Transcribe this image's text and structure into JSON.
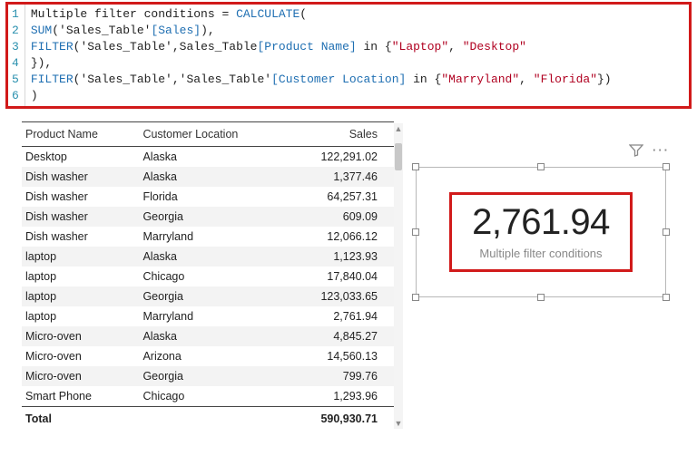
{
  "formula": {
    "lines": [
      [
        {
          "t": "Multiple filter conditions = ",
          "c": "k-plain"
        },
        {
          "t": "CALCULATE",
          "c": "k-func"
        },
        {
          "t": "(",
          "c": "k-plain"
        }
      ],
      [
        {
          "t": "SUM",
          "c": "k-func"
        },
        {
          "t": "(",
          "c": "k-plain"
        },
        {
          "t": "'Sales_Table'",
          "c": "k-plain"
        },
        {
          "t": "[Sales]",
          "c": "k-col"
        },
        {
          "t": "),",
          "c": "k-plain"
        }
      ],
      [
        {
          "t": "FILTER",
          "c": "k-func"
        },
        {
          "t": "(",
          "c": "k-plain"
        },
        {
          "t": "'Sales_Table'",
          "c": "k-plain"
        },
        {
          "t": ",Sales_Table",
          "c": "k-plain"
        },
        {
          "t": "[Product Name]",
          "c": "k-col"
        },
        {
          "t": " in {",
          "c": "k-plain"
        },
        {
          "t": "\"Laptop\"",
          "c": "k-str"
        },
        {
          "t": ", ",
          "c": "k-plain"
        },
        {
          "t": "\"Desktop\"",
          "c": "k-str"
        }
      ],
      [
        {
          "t": "}),",
          "c": "k-plain"
        }
      ],
      [
        {
          "t": "FILTER",
          "c": "k-func"
        },
        {
          "t": "(",
          "c": "k-plain"
        },
        {
          "t": "'Sales_Table'",
          "c": "k-plain"
        },
        {
          "t": ",",
          "c": "k-plain"
        },
        {
          "t": "'Sales_Table'",
          "c": "k-plain"
        },
        {
          "t": "[Customer Location]",
          "c": "k-col"
        },
        {
          "t": " in {",
          "c": "k-plain"
        },
        {
          "t": "\"Marryland\"",
          "c": "k-str"
        },
        {
          "t": ", ",
          "c": "k-plain"
        },
        {
          "t": "\"Florida\"",
          "c": "k-str"
        },
        {
          "t": "})",
          "c": "k-plain"
        }
      ],
      [
        {
          "t": ")",
          "c": "k-plain"
        }
      ]
    ],
    "line_numbers": [
      "1",
      "2",
      "3",
      "4",
      "5",
      "6"
    ]
  },
  "table": {
    "headers": [
      "Product Name",
      "Customer Location",
      "Sales"
    ],
    "rows": [
      [
        "Desktop",
        "Alaska",
        "122,291.02"
      ],
      [
        "Dish washer",
        "Alaska",
        "1,377.46"
      ],
      [
        "Dish washer",
        "Florida",
        "64,257.31"
      ],
      [
        "Dish washer",
        "Georgia",
        "609.09"
      ],
      [
        "Dish washer",
        "Marryland",
        "12,066.12"
      ],
      [
        "laptop",
        "Alaska",
        "1,123.93"
      ],
      [
        "laptop",
        "Chicago",
        "17,840.04"
      ],
      [
        "laptop",
        "Georgia",
        "123,033.65"
      ],
      [
        "laptop",
        "Marryland",
        "2,761.94"
      ],
      [
        "Micro-oven",
        "Alaska",
        "4,845.27"
      ],
      [
        "Micro-oven",
        "Arizona",
        "14,560.13"
      ],
      [
        "Micro-oven",
        "Georgia",
        "799.76"
      ],
      [
        "Smart Phone",
        "Chicago",
        "1,293.96"
      ]
    ],
    "total_label": "Total",
    "total_value": "590,930.71"
  },
  "card": {
    "value": "2,761.94",
    "label": "Multiple filter conditions"
  }
}
